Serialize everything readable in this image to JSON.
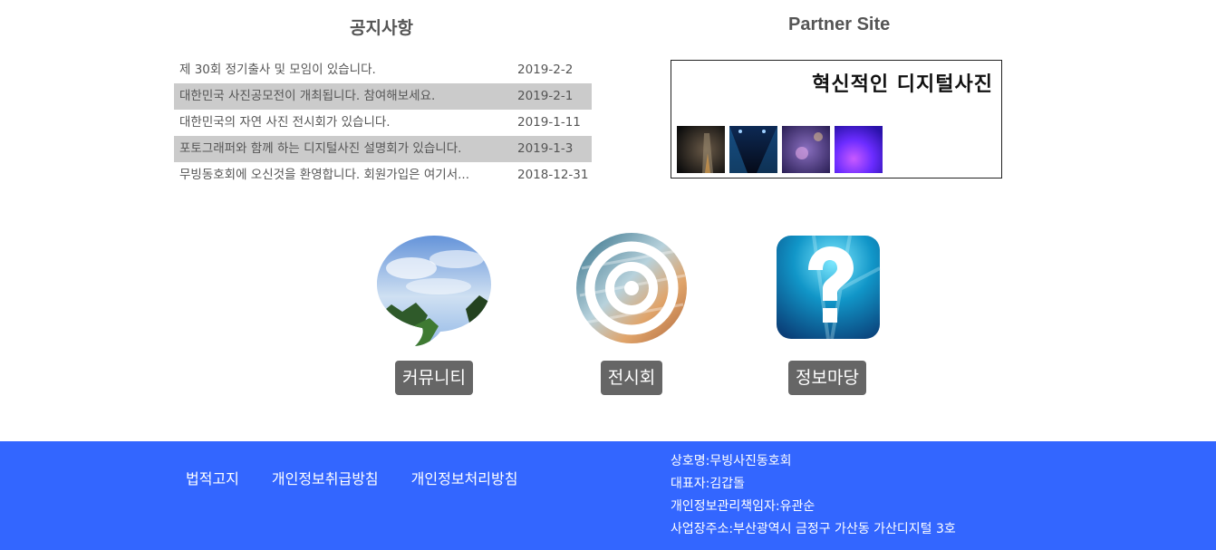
{
  "notice": {
    "title": "공지사항",
    "items": [
      {
        "title": "제 30회 정기출사 및 모임이 있습니다.",
        "date": "2019-2-2"
      },
      {
        "title": "대한민국 사진공모전이 개최됩니다. 참여해보세요.",
        "date": "2019-2-1"
      },
      {
        "title": "대한민국의 자연 사진 전시회가 있습니다.",
        "date": "2019-1-11"
      },
      {
        "title": "포토그래퍼와 함께 하는 디지털사진 설명회가 있습니다.",
        "date": "2019-1-3"
      },
      {
        "title": "무빙동호회에 오신것을 환영합니다. 회원가입은 여기서...",
        "date": "2018-12-31"
      }
    ]
  },
  "partner": {
    "title": "Partner Site",
    "headline": "혁신적인 디지털사진"
  },
  "menu": {
    "community": "커뮤니티",
    "exhibition": "전시회",
    "info": "정보마당"
  },
  "footer": {
    "links": [
      "법적고지",
      "개인정보취급방침",
      "개인정보처리방침"
    ],
    "company_name": "상호명:무빙사진동호회",
    "ceo": "대표자:김갑돌",
    "privacy_officer": "개인정보관리책임자:유관순",
    "address": "사업장주소:부산광역시 금정구 가산동 가산디지털 3호"
  },
  "colors": {
    "footer_bg": "#3366ff",
    "label_bg": "#666666",
    "row_highlight": "#cbcbcb"
  }
}
